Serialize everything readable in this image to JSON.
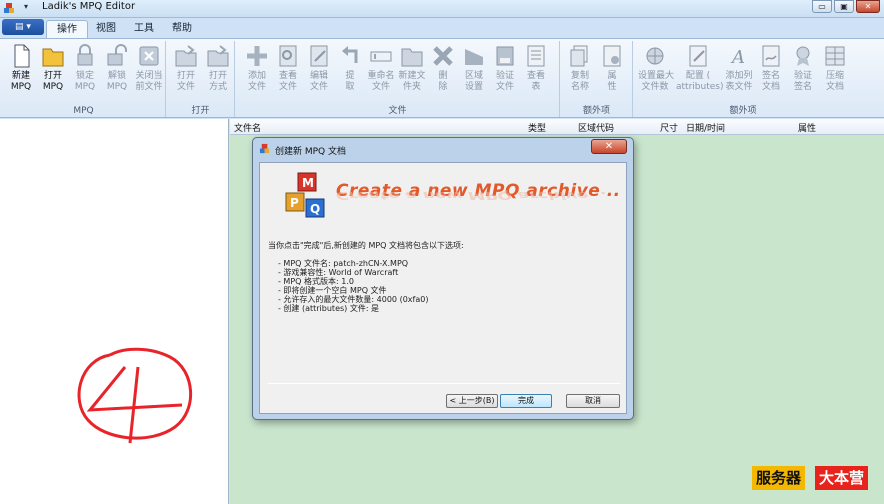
{
  "window": {
    "title": "Ladik's MPQ Editor",
    "minimize": "▭",
    "maximize": "▣",
    "close": "✕"
  },
  "app_menu": {
    "label": "▤ ▾"
  },
  "quick_access": "▾",
  "tabs": [
    {
      "label": "操作"
    },
    {
      "label": "视图"
    },
    {
      "label": "工具"
    },
    {
      "label": "帮助"
    }
  ],
  "ribbon": {
    "groups": [
      {
        "label": "MPQ",
        "buttons": [
          {
            "label": "新建\nMPQ",
            "enabled": true,
            "icon": "new-document-icon"
          },
          {
            "label": "打开\nMPQ",
            "enabled": true,
            "icon": "open-folder-icon"
          },
          {
            "label": "锁定\nMPQ",
            "enabled": false,
            "icon": "lock-icon"
          },
          {
            "label": "解锁\nMPQ",
            "enabled": false,
            "icon": "unlock-icon"
          },
          {
            "label": "关闭当\n前文件",
            "enabled": false,
            "icon": "close-file-icon"
          }
        ]
      },
      {
        "label": "打开",
        "buttons": [
          {
            "label": "打开\n文件",
            "enabled": false,
            "icon": "open-file-icon"
          },
          {
            "label": "打开\n方式",
            "enabled": false,
            "icon": "open-with-icon"
          }
        ]
      },
      {
        "label": "文件",
        "buttons": [
          {
            "label": "添加\n文件",
            "enabled": false,
            "icon": "add-icon"
          },
          {
            "label": "查看\n文件",
            "enabled": false,
            "icon": "view-file-icon"
          },
          {
            "label": "编辑\n文件",
            "enabled": false,
            "icon": "edit-file-icon"
          },
          {
            "label": "提\n取",
            "enabled": false,
            "icon": "extract-icon"
          },
          {
            "label": "重命名\n文件",
            "enabled": false,
            "icon": "rename-icon"
          },
          {
            "label": "新建文\n件夹",
            "enabled": false,
            "icon": "new-folder-icon"
          },
          {
            "label": "删\n除",
            "enabled": false,
            "icon": "delete-icon"
          },
          {
            "label": "区域\n设置",
            "enabled": false,
            "icon": "locale-icon"
          },
          {
            "label": "验证\n文件",
            "enabled": false,
            "icon": "verify-file-icon"
          },
          {
            "label": "查看\n表",
            "enabled": false,
            "icon": "view-table-icon"
          }
        ]
      },
      {
        "label": "额外项",
        "buttons": [
          {
            "label": "复制\n名称",
            "enabled": false,
            "icon": "copy-name-icon"
          },
          {
            "label": "属\n性",
            "enabled": false,
            "icon": "properties-icon"
          }
        ]
      },
      {
        "label": "额外项",
        "buttons": [
          {
            "label": "设置最大\n文件数",
            "enabled": false,
            "icon": "max-files-icon"
          },
          {
            "label": "配置 (\nattributes)",
            "enabled": false,
            "icon": "configure-icon"
          },
          {
            "label": "添加列\n表文件",
            "enabled": false,
            "icon": "add-listfile-icon"
          },
          {
            "label": "签名\n文档",
            "enabled": false,
            "icon": "sign-icon"
          },
          {
            "label": "验证\n签名",
            "enabled": false,
            "icon": "verify-signature-icon"
          },
          {
            "label": "压缩\n文档",
            "enabled": false,
            "icon": "compact-icon"
          }
        ]
      }
    ]
  },
  "columns": [
    "文件名",
    "类型",
    "区域代码",
    "尺寸",
    "日期/时间",
    "属性"
  ],
  "dialog": {
    "title": "创建新 MPQ 文档",
    "close": "✕",
    "banner_text": "Create a new MPQ archive ..",
    "intro": "当你点击\"完成\"后,新创建的 MPQ 文档将包含以下选项:",
    "details": [
      "- MPQ 文件名: patch-zhCN-X.MPQ",
      "- 游戏兼容性: World of Warcraft",
      "- MPQ 格式版本: 1.0",
      "- 即将创建一个空白 MPQ 文件",
      "- 允许存入的最大文件数量: 4000 (0xfa0)",
      "- 创建 (attributes) 文件: 是"
    ],
    "back_button": "< 上一步(B)",
    "finish_button": "完成",
    "cancel_button": "取消"
  },
  "watermark": {
    "part1": "服务器",
    "part2": "大本营"
  },
  "colors": {
    "accent": "#1c4e9e",
    "workspace": "#c9e6cd",
    "banner": "#e25a2b",
    "annotation": "#e8232a"
  }
}
